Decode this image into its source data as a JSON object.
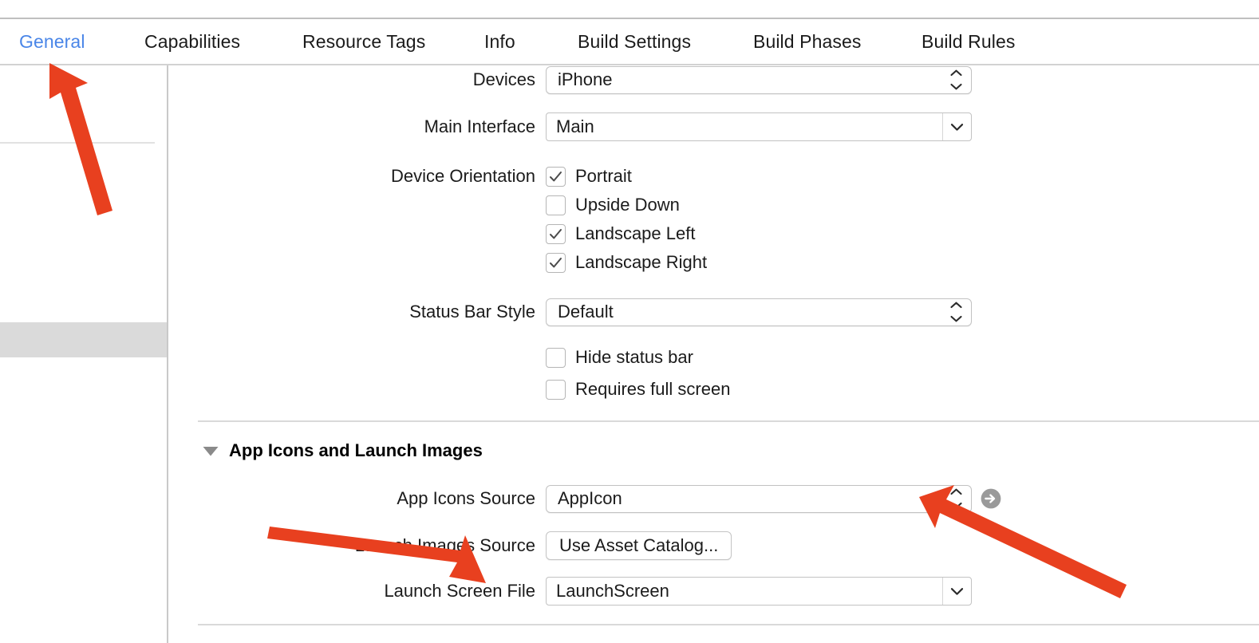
{
  "window": {
    "app": "Xcode",
    "pane": "target-editor"
  },
  "tabs": [
    {
      "label": "General",
      "selected": true
    },
    {
      "label": "Capabilities",
      "selected": false
    },
    {
      "label": "Resource Tags",
      "selected": false
    },
    {
      "label": "Info",
      "selected": false
    },
    {
      "label": "Build Settings",
      "selected": false
    },
    {
      "label": "Build Phases",
      "selected": false
    },
    {
      "label": "Build Rules",
      "selected": false
    }
  ],
  "deployment_info": {
    "devices": {
      "label": "Devices",
      "value": "iPhone",
      "control": "popup-button"
    },
    "main_interface": {
      "label": "Main Interface",
      "value": "Main",
      "control": "combo-box"
    },
    "device_orientation": {
      "label": "Device Orientation",
      "options": [
        {
          "label": "Portrait",
          "checked": true
        },
        {
          "label": "Upside Down",
          "checked": false
        },
        {
          "label": "Landscape Left",
          "checked": true
        },
        {
          "label": "Landscape Right",
          "checked": true
        }
      ]
    },
    "status_bar_style": {
      "label": "Status Bar Style",
      "value": "Default",
      "control": "popup-button"
    },
    "status_bar_options": [
      {
        "label": "Hide status bar",
        "checked": false
      },
      {
        "label": "Requires full screen",
        "checked": false
      }
    ]
  },
  "app_icons_section": {
    "title": "App Icons and Launch Images",
    "expanded": true,
    "app_icons_source": {
      "label": "App Icons Source",
      "value": "AppIcon",
      "control": "popup-button",
      "reveal_icon": "arrow-right-circle-icon"
    },
    "launch_images_source": {
      "label": "Launch Images Source",
      "button_label": "Use Asset Catalog..."
    },
    "launch_screen_file": {
      "label": "Launch Screen File",
      "value": "LaunchScreen",
      "control": "combo-box"
    }
  },
  "annotations": [
    {
      "name": "arrow-to-general-tab",
      "color": "#E8401F"
    },
    {
      "name": "arrow-to-app-icons-source",
      "color": "#E8401F"
    },
    {
      "name": "arrow-to-launch-screen-file",
      "color": "#E8401F"
    }
  ],
  "colors": {
    "accent_blue": "#4a86e8",
    "annotation_red": "#E8401F",
    "selection_gray": "#dadada",
    "border_gray": "#c2c2c2"
  }
}
